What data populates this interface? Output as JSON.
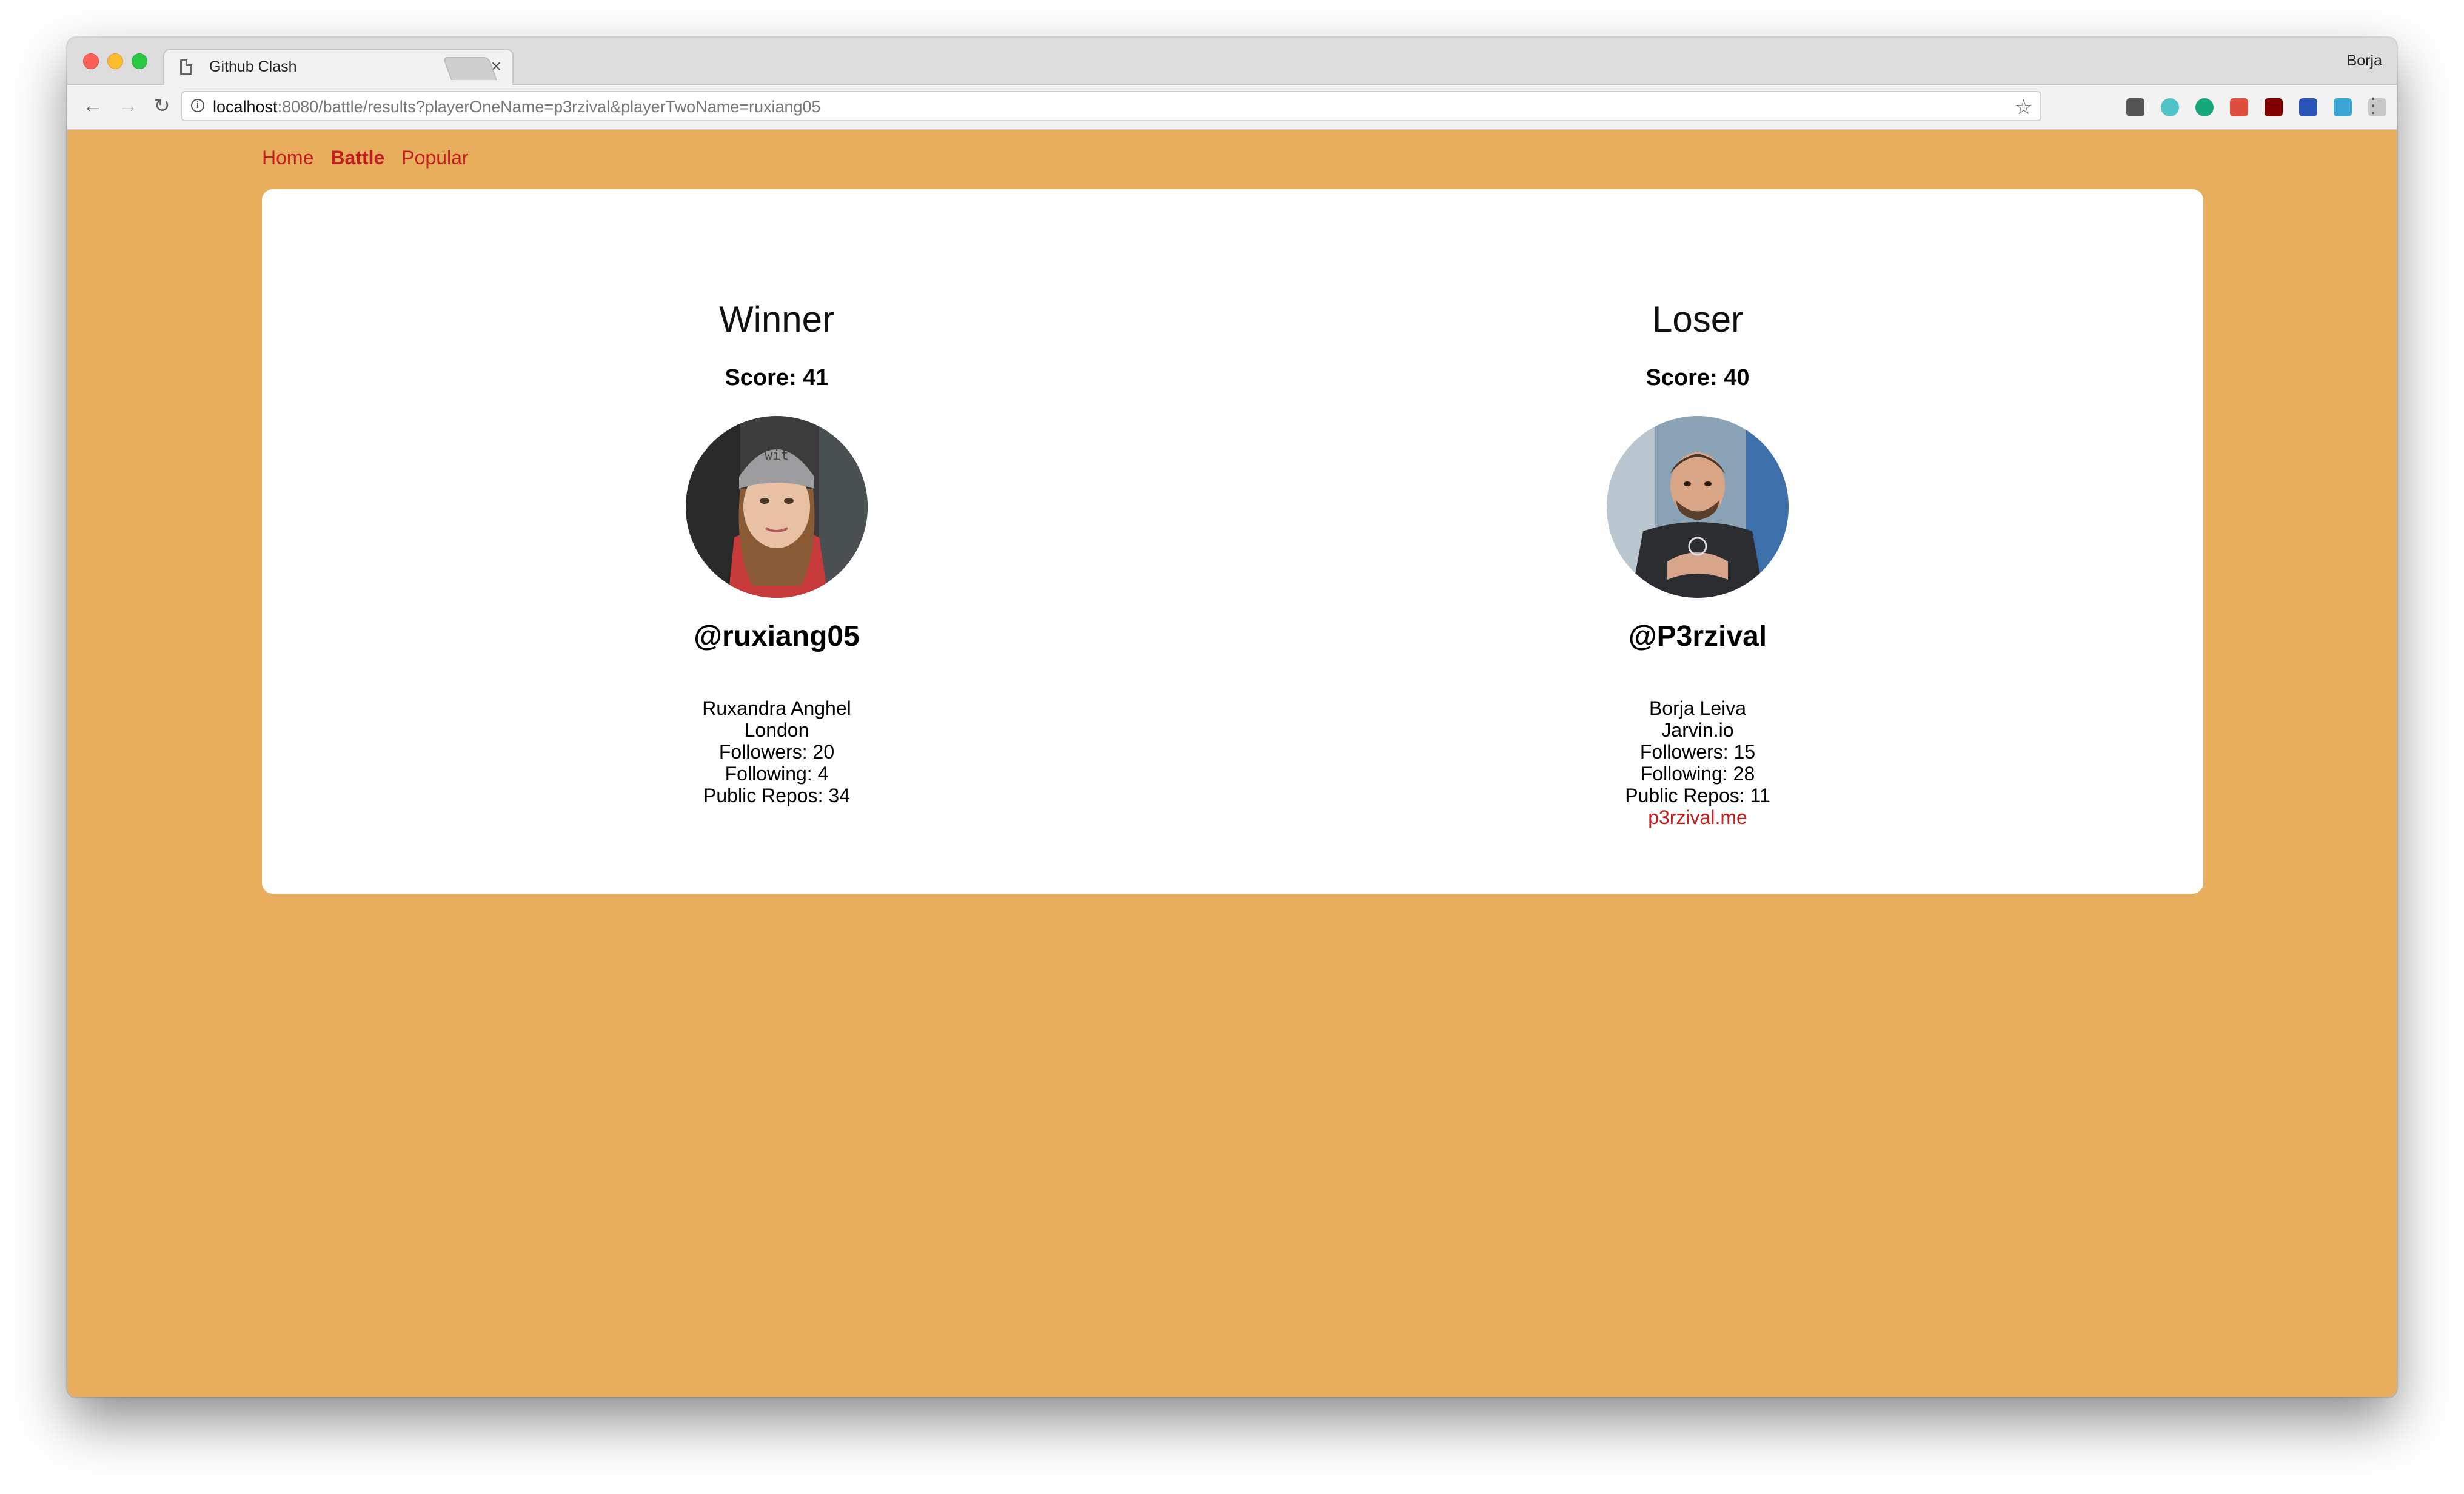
{
  "browser": {
    "tab_title": "Github Clash",
    "tab_close": "×",
    "profile_name": "Borja",
    "url_host": "localhost",
    "url_rest": ":8080/battle/results?playerOneName=p3rzival&playerTwoName=ruxiang05",
    "extensions": [
      {
        "name": "pocket-icon",
        "color": "#555555"
      },
      {
        "name": "ext-teal-icon",
        "color": "#4fc3c8"
      },
      {
        "name": "grammarly-icon",
        "color": "#17a87b"
      },
      {
        "name": "ext-red-icon",
        "color": "#e04e3e"
      },
      {
        "name": "ublock-icon",
        "color": "#800000"
      },
      {
        "name": "ext-blue-60-icon",
        "color": "#2a53b8"
      },
      {
        "name": "ext-g-icon",
        "color": "#3aa4d4"
      },
      {
        "name": "ext-search-icon",
        "color": "#c8c8c8"
      },
      {
        "name": "ext-red-box-icon",
        "color": "#c43b3b"
      }
    ]
  },
  "nav": {
    "items": [
      {
        "label": "Home",
        "active": false
      },
      {
        "label": "Battle",
        "active": true
      },
      {
        "label": "Popular",
        "active": false
      }
    ]
  },
  "results": {
    "winner": {
      "heading": "Winner",
      "score": "Score: 41",
      "login": "@ruxiang05",
      "name": "Ruxandra Anghel",
      "location": "London",
      "followers": "Followers: 20",
      "following": "Following: 4",
      "repos": "Public Repos: 34"
    },
    "loser": {
      "heading": "Loser",
      "score": "Score: 40",
      "login": "@P3rzival",
      "name": "Borja Leiva",
      "location": "Jarvin.io",
      "followers": "Followers: 15",
      "following": "Following: 28",
      "repos": "Public Repos: 11",
      "blog": "p3rzival.me"
    }
  },
  "colors": {
    "page_background": "#e8ae5e",
    "link": "#c21e1e"
  }
}
